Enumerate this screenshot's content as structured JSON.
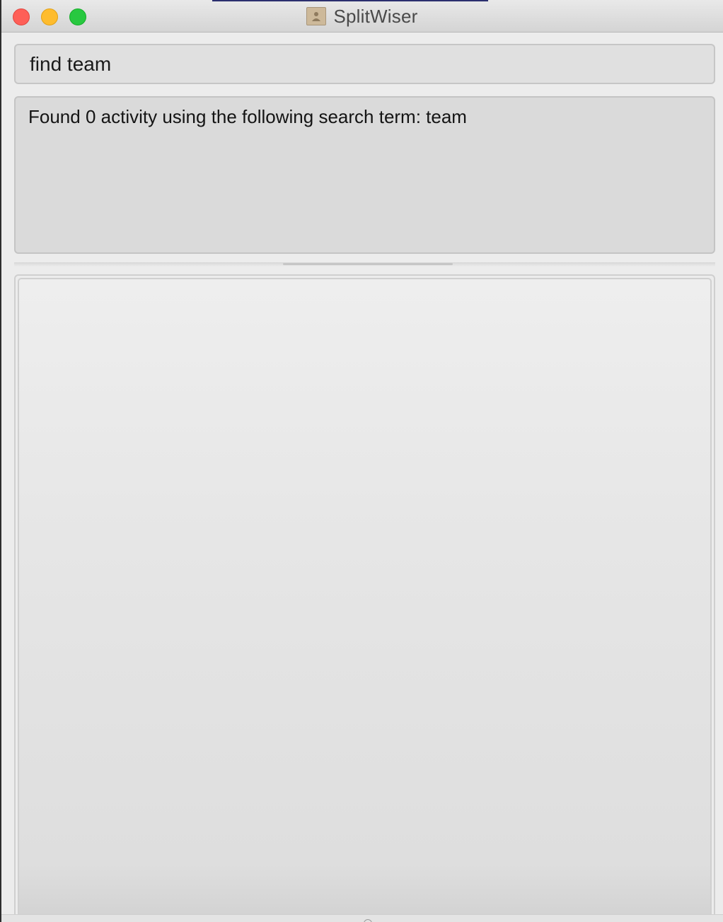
{
  "window": {
    "title": "SplitWiser",
    "icon": "app-document-icon"
  },
  "traffic_lights": {
    "close_color": "#fe5f57",
    "minimize_color": "#febc2e",
    "zoom_color": "#28c840"
  },
  "command_box": {
    "value": "find team"
  },
  "result_display": {
    "text": "Found 0 activity using the following search term: team"
  },
  "activity_list": {
    "items": []
  }
}
